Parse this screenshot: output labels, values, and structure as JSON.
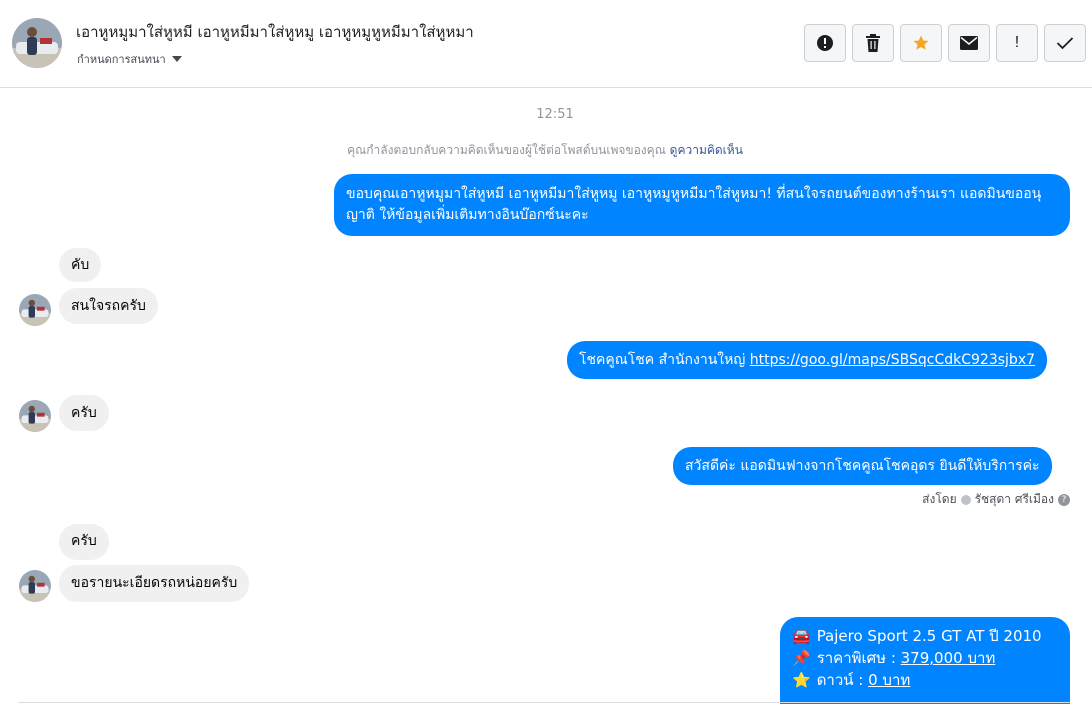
{
  "header": {
    "contact_name": "เอาหูหมูมาใส่หูหมี เอาหูหมีมาใส่หูหมู เอาหูหมูหูหมีมาใส่หูหมา",
    "assign_label": "กำหนดการสนทนา"
  },
  "toolbar": {
    "buttons": [
      {
        "icon": "alert-circle-icon"
      },
      {
        "icon": "trash-icon"
      },
      {
        "icon": "star-icon",
        "color": "#f5a623"
      },
      {
        "icon": "envelope-icon"
      },
      {
        "icon": "exclamation-icon",
        "text": "!"
      },
      {
        "icon": "checkmark-icon"
      }
    ]
  },
  "thread": {
    "timestamp": "12:51",
    "notice_text": "คุณกำลังตอบกลับความคิดเห็นของผู้ใช้ต่อโพสต์บนเพจของคุณ",
    "notice_link": "ดูความคิดเห็น",
    "messages": [
      {
        "direction": "out",
        "text": "ขอบคุณเอาหูหมูมาใส่หูหมี เอาหูหมีมาใส่หูหมู เอาหูหมูหูหมีมาใส่หูหมา! ที่สนใจรถยนต์ของทางร้านเรา แอดมินขออนุญาติ ให้ข้อมูลเพิ่มเติมทางอินบ๊อกซ์นะคะ"
      },
      {
        "direction": "in",
        "text": "คับ"
      },
      {
        "direction": "in",
        "text": "สนใจรถครับ"
      },
      {
        "direction": "out",
        "text": "โชคคูณโชค สำนักงานใหญ่ ",
        "link": "https://goo.gl/maps/SBSqcCdkC923sjbx7"
      },
      {
        "direction": "in",
        "text": "ครับ"
      },
      {
        "direction": "out",
        "text": "สวัสดีค่ะ แอดมินฟางจากโชคคูณโชคอุดร ยินดีให้บริการค่ะ"
      },
      {
        "direction": "in",
        "text": "ครับ"
      },
      {
        "direction": "in",
        "text": "ขอรายนะเอียดรถหน่อยครับ"
      }
    ],
    "sent_by_label": "ส่งโดย",
    "sent_by_name": "รัชสุดา ศรีเมือง",
    "card": {
      "line1_emoji": "🚘",
      "line1": "Pajero Sport 2.5 GT AT ปี 2010",
      "line2_emoji": "📌",
      "line2_label": "ราคาพิเศษ : ",
      "line2_value": "379,000 บาท",
      "line3_emoji": "⭐",
      "line3_label": "ดาวน์ : ",
      "line3_value": "0 บาท"
    }
  },
  "colors": {
    "outgoing_bubble": "#0084ff",
    "incoming_bubble": "#f1f0f0",
    "link": "#365899"
  }
}
